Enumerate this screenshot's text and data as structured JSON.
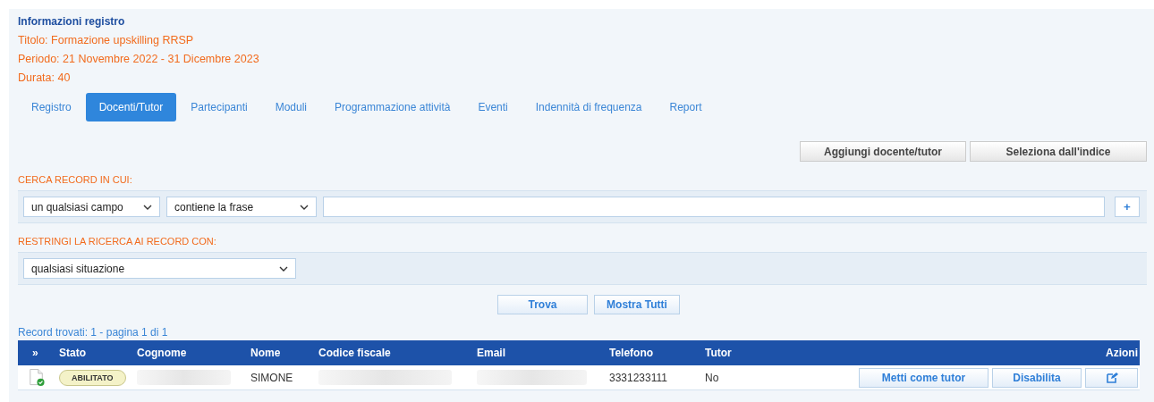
{
  "info": {
    "heading": "Informazioni registro",
    "lines": [
      "Titolo: Formazione upskilling RRSP",
      "Periodo: 21 Novembre 2022 - 31 Dicembre 2023",
      "Durata: 40"
    ]
  },
  "tabs": [
    {
      "label": "Registro",
      "selected": false
    },
    {
      "label": "Docenti/Tutor",
      "selected": true
    },
    {
      "label": "Partecipanti",
      "selected": false
    },
    {
      "label": "Moduli",
      "selected": false
    },
    {
      "label": "Programmazione attività",
      "selected": false
    },
    {
      "label": "Eventi",
      "selected": false
    },
    {
      "label": "Indennità di frequenza",
      "selected": false
    },
    {
      "label": "Report",
      "selected": false
    }
  ],
  "top_buttons": [
    "Aggiungi docente/tutor",
    "Seleziona dall'indice"
  ],
  "search": {
    "label": "CERCA RECORD IN CUI:",
    "field_select": "un qualsiasi campo",
    "operator_select": "contiene la frase",
    "add_button": "+"
  },
  "restrict": {
    "label": "RESTRINGI LA RICERCA AI RECORD CON:",
    "select": "qualsiasi situazione"
  },
  "search_buttons": [
    "Trova",
    "Mostra Tutti"
  ],
  "results_summary": "Record trovati: 1 - pagina 1 di 1",
  "table": {
    "columns": [
      "»",
      "Stato",
      "Cognome",
      "Nome",
      "Codice fiscale",
      "Email",
      "Telefono",
      "Tutor",
      "Azioni"
    ],
    "rows": [
      {
        "status": "ABILITATO",
        "cognome": {
          "redacted": true
        },
        "nome": "SIMONE",
        "codice_fiscale": {
          "redacted": true
        },
        "email": {
          "redacted": true
        },
        "telefono": "3331233111",
        "tutor": "No",
        "actions": [
          "Metti come tutor",
          "Disabilita"
        ]
      }
    ]
  }
}
